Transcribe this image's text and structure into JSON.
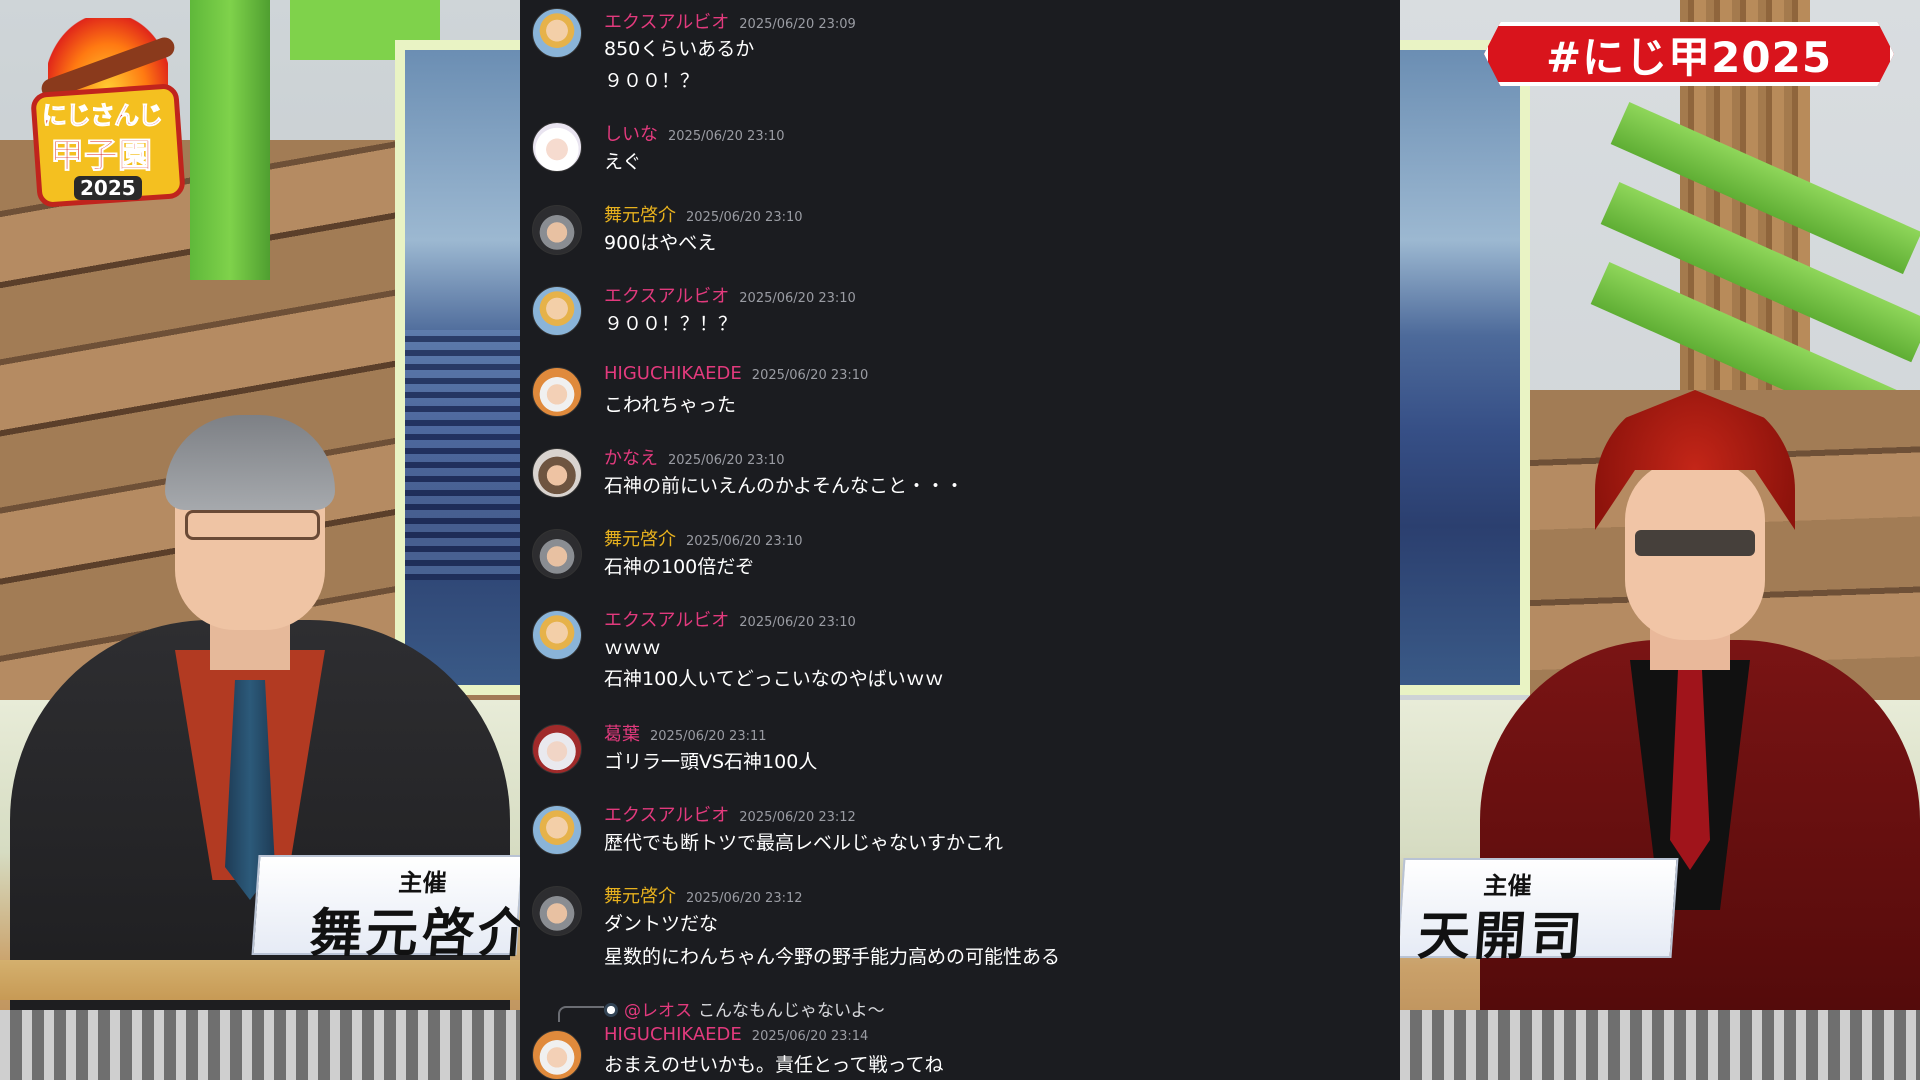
{
  "event": {
    "logo_line1": "にじさんじ",
    "logo_line2": "甲子園",
    "logo_year": "2025",
    "hashtag": "#にじ甲2025"
  },
  "hosts": {
    "left": {
      "role": "主催",
      "name": "舞元啓介"
    },
    "right": {
      "role": "主催",
      "name": "天開司"
    }
  },
  "chat": {
    "messages": [
      {
        "user": "エクスアルビオ",
        "color": "#e23a7d",
        "time": "2025/06/20 23:09",
        "lines": [
          "850くらいあるか",
          "９００！？"
        ]
      },
      {
        "user": "しいな",
        "color": "#e23a7d",
        "time": "2025/06/20 23:10",
        "lines": [
          "えぐ"
        ]
      },
      {
        "user": "舞元啓介",
        "color": "#e7b11e",
        "time": "2025/06/20 23:10",
        "lines": [
          "900はやべえ"
        ]
      },
      {
        "user": "エクスアルビオ",
        "color": "#e23a7d",
        "time": "2025/06/20 23:10",
        "lines": [
          "９００！？！？"
        ]
      },
      {
        "user": "HIGUCHIKAEDE",
        "color": "#e23a7d",
        "time": "2025/06/20 23:10",
        "lines": [
          "こわれちゃった"
        ]
      },
      {
        "user": "かなえ",
        "color": "#e23a7d",
        "time": "2025/06/20 23:10",
        "lines": [
          "石神の前にいえんのかよそんなこと・・・"
        ]
      },
      {
        "user": "舞元啓介",
        "color": "#e7b11e",
        "time": "2025/06/20 23:10",
        "lines": [
          "石神の100倍だぞ"
        ]
      },
      {
        "user": "エクスアルビオ",
        "color": "#e23a7d",
        "time": "2025/06/20 23:10",
        "lines": [
          "ｗｗｗ",
          "石神100人いてどっこいなのやばいｗｗ"
        ]
      },
      {
        "user": "葛葉",
        "color": "#e23a7d",
        "time": "2025/06/20 23:11",
        "lines": [
          "ゴリラ一頭VS石神100人"
        ]
      },
      {
        "user": "エクスアルビオ",
        "color": "#e23a7d",
        "time": "2025/06/20 23:12",
        "lines": [
          "歴代でも断トツで最高レベルじゃないすかこれ"
        ]
      },
      {
        "user": "舞元啓介",
        "color": "#e7b11e",
        "time": "2025/06/20 23:12",
        "lines": [
          "ダントツだな",
          "星数的にわんちゃん今野の野手能力高めの可能性ある"
        ]
      },
      {
        "user": "HIGUCHIKAEDE",
        "color": "#e23a7d",
        "time": "2025/06/20 23:14",
        "lines": [
          "おまえのせいかも。責任とって戦ってね"
        ],
        "reply_to": {
          "user": "@レオス",
          "text": "こんなもんじゃないよ～"
        }
      }
    ]
  }
}
